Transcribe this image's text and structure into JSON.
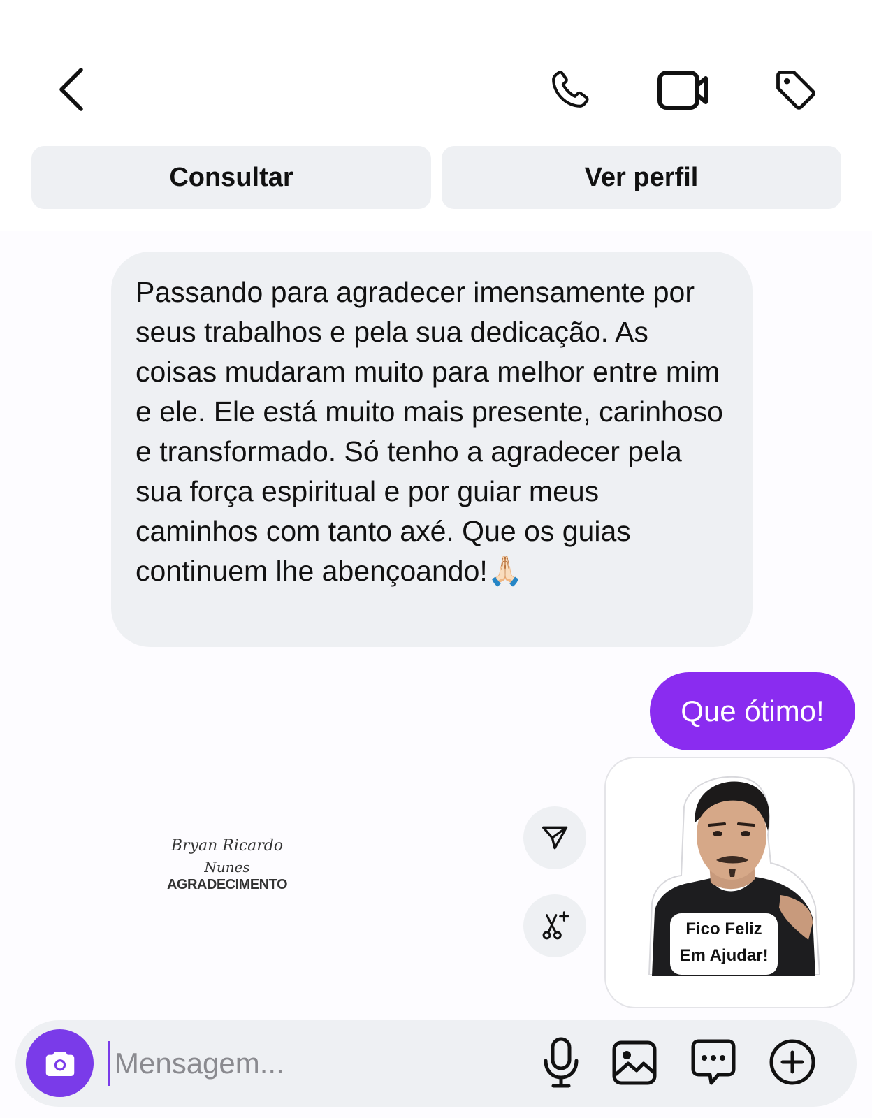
{
  "header": {
    "consult_label": "Consultar",
    "profile_label": "Ver perfil",
    "icons": [
      "back-icon",
      "phone-icon",
      "video-call-icon",
      "tag-icon"
    ]
  },
  "messages": [
    {
      "direction": "incoming",
      "text": "Passando para agradecer imensamente por seus trabalhos e pela sua dedicação. As coisas mudaram muito para melhor entre mim e ele. Ele está muito mais presente, carinhoso e transformado. Só tenho a agradecer pela sua força espiritual e por guiar meus caminhos com tanto axé. Que os guias continuem lhe abençoando!🙏🏻"
    },
    {
      "direction": "outgoing",
      "text": "Que ótimo!"
    },
    {
      "direction": "outgoing",
      "type": "sticker",
      "caption_line1": "Fico Feliz",
      "caption_line2": "Em Ajudar!"
    }
  ],
  "watermark": {
    "line1": "Bryan Ricardo",
    "line2": "Nunes",
    "line3": "AGRADECIMENTO"
  },
  "composer": {
    "placeholder": "Mensagem...",
    "icons": [
      "camera-icon",
      "microphone-icon",
      "gallery-icon",
      "sticker-chat-icon",
      "plus-icon"
    ]
  },
  "colors": {
    "accent": "#8a2cf0",
    "bubble_in": "#eef0f3",
    "camera_button": "#7a3be9"
  }
}
